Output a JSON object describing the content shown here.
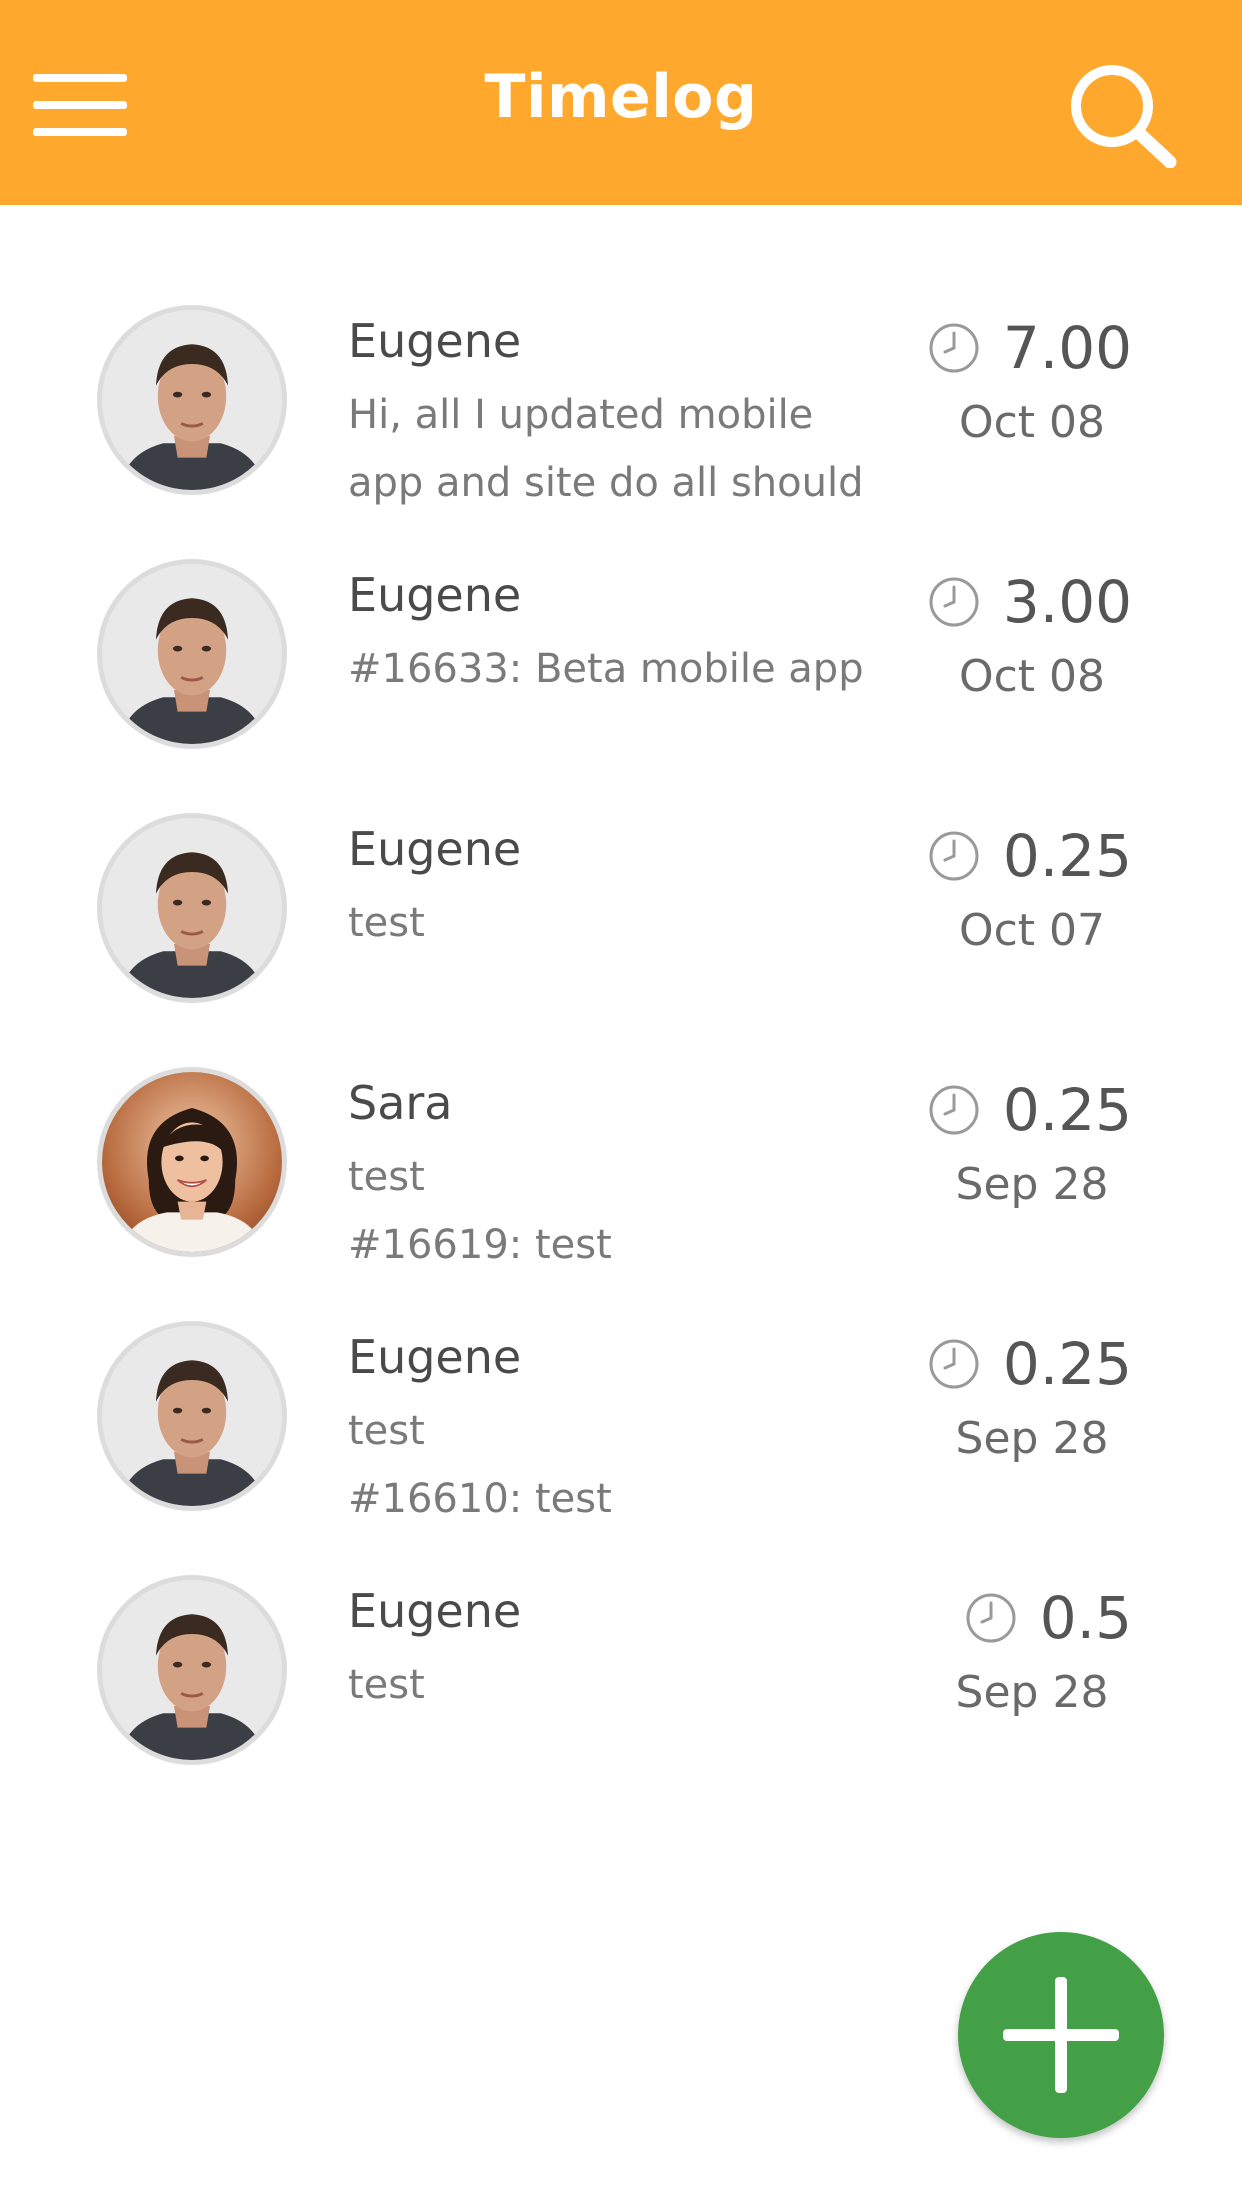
{
  "header": {
    "title": "Timelog",
    "menu_icon": "hamburger-menu-icon",
    "search_icon": "search-icon",
    "background_color": "#FFA82E"
  },
  "entries": [
    {
      "name": "Eugene",
      "description_lines": [
        "Hi, all I updated mobile",
        "app and site do all should"
      ],
      "hours": "7.00",
      "date": "Oct 08",
      "avatar": "man"
    },
    {
      "name": "Eugene",
      "description_lines": [
        "#16633: Beta mobile app"
      ],
      "hours": "3.00",
      "date": "Oct 08",
      "avatar": "man"
    },
    {
      "name": "Eugene",
      "description_lines": [
        "test"
      ],
      "hours": "0.25",
      "date": "Oct 07",
      "avatar": "man"
    },
    {
      "name": "Sara",
      "description_lines": [
        "test",
        "#16619: test"
      ],
      "hours": "0.25",
      "date": "Sep 28",
      "avatar": "woman"
    },
    {
      "name": "Eugene",
      "description_lines": [
        "test",
        "#16610: test"
      ],
      "hours": "0.25",
      "date": "Sep 28",
      "avatar": "man"
    },
    {
      "name": "Eugene",
      "description_lines": [
        "test"
      ],
      "hours": "0.5",
      "date": "Sep 28",
      "avatar": "man"
    }
  ],
  "fab": {
    "icon": "plus-icon",
    "color": "#43A047"
  }
}
